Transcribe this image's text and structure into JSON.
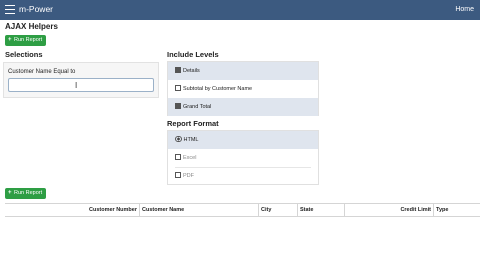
{
  "header": {
    "app_title": "m-Power",
    "home_link": "Home",
    "menu_icon": "hamburger-menu-icon"
  },
  "page": {
    "title": "AJAX Helpers",
    "run_report_label": "Run Report"
  },
  "selections": {
    "heading": "Selections",
    "field_label": "Customer Name Equal to",
    "field_value": ""
  },
  "include_levels": {
    "heading": "Include Levels",
    "options": [
      {
        "label": "Details",
        "checked": true
      },
      {
        "label": "Subtotal by Customer Name",
        "checked": false
      },
      {
        "label": "Grand Total",
        "checked": true
      }
    ]
  },
  "report_format": {
    "heading": "Report Format",
    "options": [
      {
        "label": "HTML",
        "selected": true
      },
      {
        "label": "Excel",
        "selected": false
      },
      {
        "label": "PDF",
        "selected": false
      }
    ]
  },
  "table": {
    "columns": [
      "Customer Number",
      "Customer Name",
      "City",
      "State",
      "Credit Limit",
      "Type"
    ]
  }
}
